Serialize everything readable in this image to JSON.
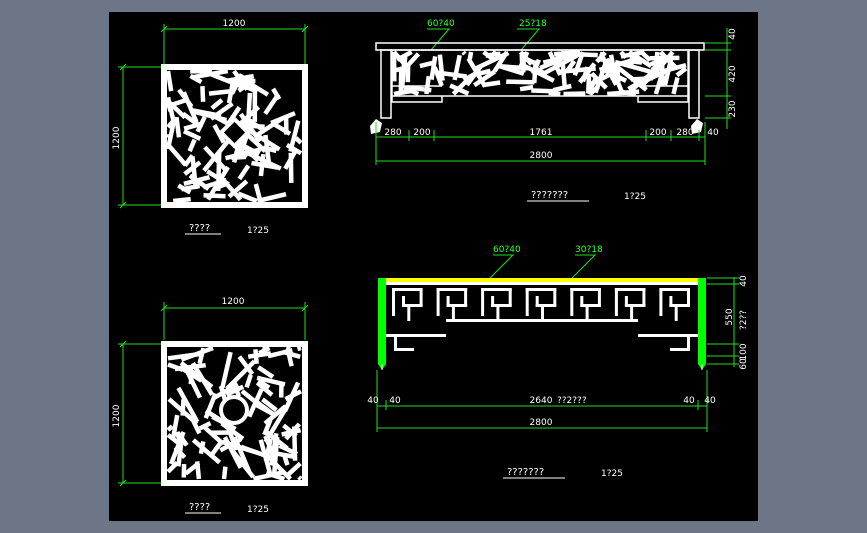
{
  "colors": {
    "background": "#000000",
    "frame": "#6d7687",
    "dim_green": "#22dd22",
    "label_green": "#33ff33",
    "white": "#ffffff",
    "yellow": "#ffff00",
    "leg_green": "#00ff00"
  },
  "panel_top": {
    "width_dim": "1200",
    "height_dim": "1200",
    "title": "????",
    "scale": "1?25"
  },
  "panel_bottom": {
    "width_dim": "1200",
    "height_dim": "1200",
    "title": "????",
    "scale": "1?25"
  },
  "elev_top": {
    "leader_left": "60?40",
    "leader_right": "25?18",
    "right_dims": [
      "40",
      "420",
      "230"
    ],
    "bottom_dims": [
      "280",
      "200",
      "1761",
      "200",
      "280",
      "40"
    ],
    "overall": "2800",
    "title": "???????",
    "scale": "1?25"
  },
  "elev_bottom": {
    "leader_left": "60?40",
    "leader_right": "30?18",
    "right_dims": [
      "40",
      "550",
      "?2??",
      "100",
      "60"
    ],
    "bottom_dims": [
      "40",
      "40",
      "2640",
      "??2???",
      "40",
      "40"
    ],
    "overall": "2800",
    "title": "???????",
    "scale": "1?25"
  }
}
